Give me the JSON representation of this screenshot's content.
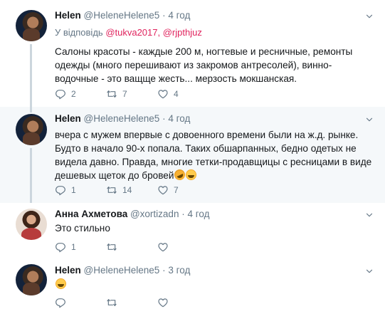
{
  "tweets": [
    {
      "name": "Helen",
      "handle": "@HeleneHelene5",
      "dot": "·",
      "time": "4 год",
      "reply_prefix": "У відповідь",
      "reply_users": "@tukva2017, @rjpthjuz",
      "text": "Салоны красоты - каждые 200 м, ногтевые и ресничные, ремонты одежды (много перешивают из закромов антресолей), винно-водочные - это ващще жесть... мерзость мокшанская.",
      "replies": "2",
      "retweets": "7",
      "likes": "4"
    },
    {
      "name": "Helen",
      "handle": "@HeleneHelene5",
      "dot": "·",
      "time": "4 год",
      "text": "вчера с мужем впервые с довоенного времени были на ж.д. рынке. Будто в начало 90-х попала. Таких обшарпанных, бедно одетых не видела давно. Правда, многие тетки-продавщицы с ресницами в виде дешевых щеток до бровей",
      "replies": "1",
      "retweets": "14",
      "likes": "7"
    },
    {
      "name": "Анна Ахметова",
      "handle": "@xortizadn",
      "dot": "·",
      "time": "4 год",
      "text": "Это стильно",
      "replies": "1",
      "retweets": "",
      "likes": ""
    },
    {
      "name": "Helen",
      "handle": "@HeleneHelene5",
      "dot": "·",
      "time": "3 год",
      "text": "",
      "replies": "",
      "retweets": "",
      "likes": ""
    }
  ],
  "icons": {
    "reply": "reply-icon",
    "retweet": "retweet-icon",
    "like": "heart-icon",
    "caret": "chevron-down-icon",
    "emoji_rofl": "rofl-emoji-icon",
    "emoji_grin": "grin-emoji-icon"
  },
  "colors": {
    "thread_line": "#ccd6dd",
    "mention": "#e0245e",
    "secondary_text": "#657786",
    "hover_background": "#f5f8fa"
  }
}
